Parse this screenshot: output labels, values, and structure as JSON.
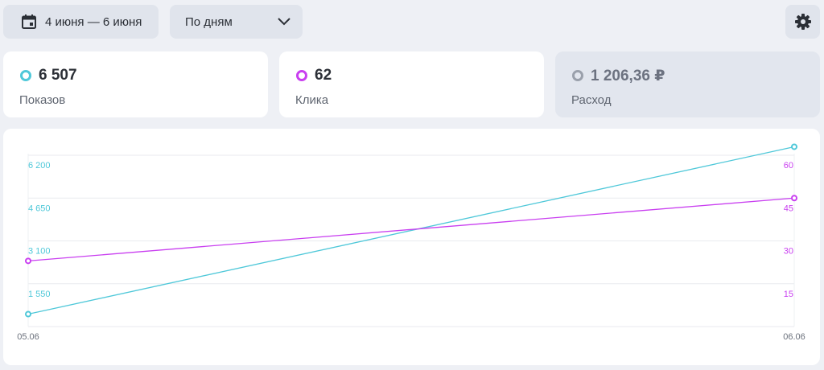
{
  "toolbar": {
    "date_range": "4 июня — 6 июня",
    "grouping": "По дням"
  },
  "metrics": [
    {
      "value": "6 507",
      "label": "Показов",
      "color": "#4fc8d9",
      "active": true
    },
    {
      "value": "62",
      "label": "Клика",
      "color": "#c93ff0",
      "active": true
    },
    {
      "value": "1 206,36 ₽",
      "label": "Расход",
      "color": "#9aa0ab",
      "active": false
    }
  ],
  "chart_data": {
    "type": "line",
    "x": [
      "05.06",
      "06.06"
    ],
    "series": [
      {
        "name": "Показов",
        "axis": "left",
        "color": "#4fc8d9",
        "values": [
          450,
          6507
        ]
      },
      {
        "name": "Клика",
        "axis": "right",
        "color": "#c93ff0",
        "values": [
          23,
          45
        ]
      }
    ],
    "y_left": {
      "ticks": [
        "6 200",
        "4 650",
        "3 100",
        "1 550"
      ],
      "tick_values": [
        6200,
        4650,
        3100,
        1550
      ],
      "range": [
        0,
        6200
      ]
    },
    "y_right": {
      "ticks": [
        "60",
        "45",
        "30",
        "15"
      ],
      "tick_values": [
        60,
        45,
        30,
        15
      ],
      "range": [
        0,
        60
      ]
    },
    "grid": true
  }
}
